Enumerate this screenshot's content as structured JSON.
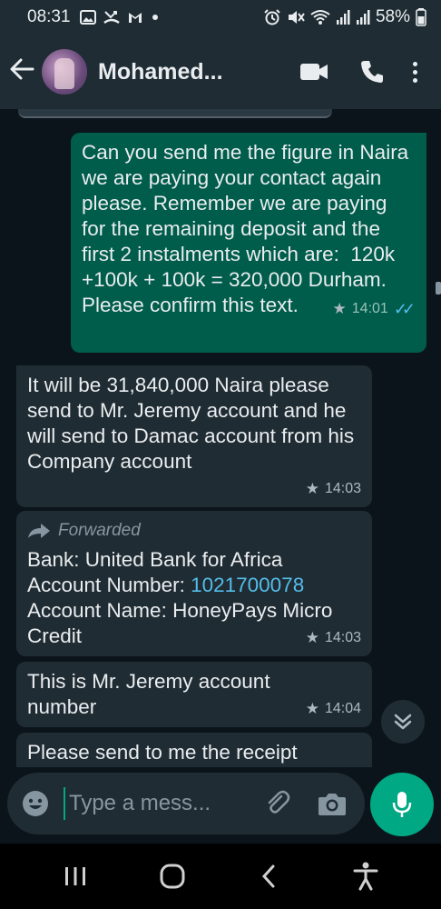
{
  "status_bar": {
    "time": "08:31",
    "battery": "58%",
    "left_icons": [
      "gallery-icon",
      "missed-call-icon",
      "gmail-icon",
      "dot-icon"
    ],
    "right_icons": [
      "alarm-icon",
      "mute-icon",
      "wifi-icon",
      "signal-icon",
      "signal-icon",
      "battery-icon"
    ]
  },
  "header": {
    "contact_name": "Mohamed...",
    "actions": [
      "video-call-icon",
      "voice-call-icon",
      "menu-icon"
    ]
  },
  "messages": [
    {
      "direction": "outgoing",
      "text": "Can you send me the figure in Naira we are paying your contact again please. Remember we are paying for the remaining deposit and the first 2 instalments which are:  120k +100k + 100k = 320,000 Durham. Please confirm this text.",
      "time": "14:01",
      "starred": true,
      "read": true
    },
    {
      "direction": "incoming",
      "text": "It will be 31,840,000 Naira please send to Mr. Jeremy account and he will send to Damac account from his Company account",
      "time": "14:03",
      "starred": true
    },
    {
      "direction": "incoming",
      "forwarded_label": "Forwarded",
      "line1": "Bank: United Bank for Africa",
      "line2_prefix": "Account Number: ",
      "account_number": "1021700078",
      "line3": "Account Name: HoneyPays Micro Credit",
      "time": "14:03",
      "starred": true
    },
    {
      "direction": "incoming",
      "text": "This is Mr. Jeremy account number",
      "time": "14:04",
      "starred": true
    },
    {
      "direction": "incoming",
      "text": "Please send to me the receipt"
    }
  ],
  "composer": {
    "placeholder": "Type a mess..."
  },
  "colors": {
    "background": "#0b141a",
    "header": "#1f2c34",
    "outgoing_bubble": "#005c4b",
    "incoming_bubble": "#202c33",
    "accent": "#00a884",
    "link": "#53bdeb"
  }
}
